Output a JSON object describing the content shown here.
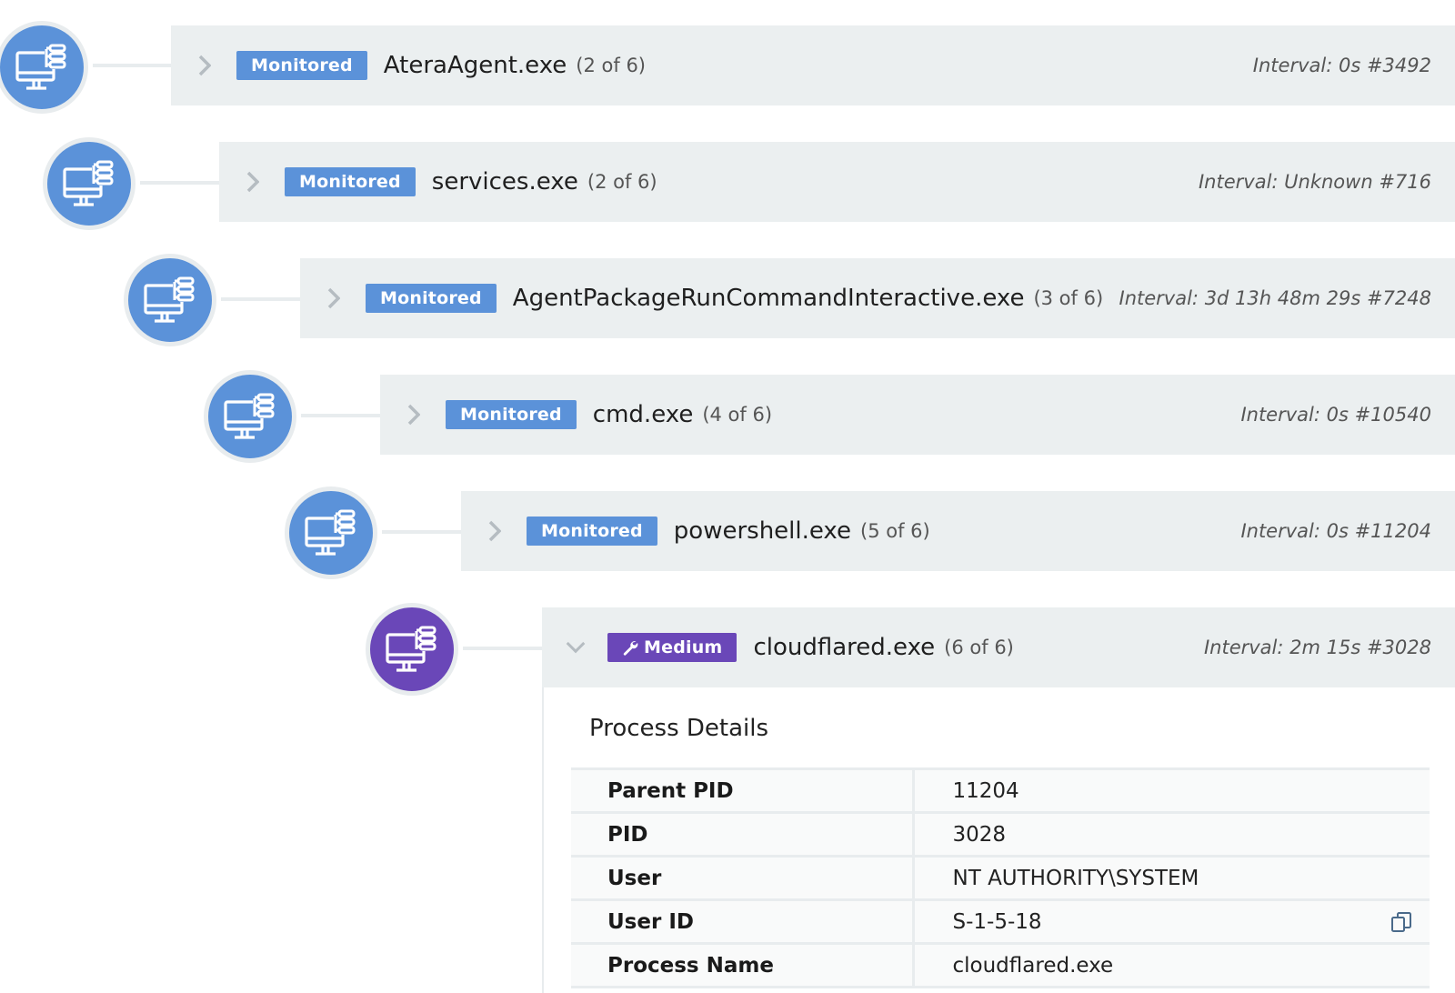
{
  "tree": [
    {
      "badge": "Monitored",
      "name": "AteraAgent.exe",
      "count": "(2 of 6)",
      "interval": "Interval: 0s #3492",
      "color": "#5b92d9"
    },
    {
      "badge": "Monitored",
      "name": "services.exe",
      "count": "(2 of 6)",
      "interval": "Interval: Unknown #716",
      "color": "#5b92d9"
    },
    {
      "badge": "Monitored",
      "name": "AgentPackageRunCommandInteractive.exe",
      "count": "(3 of 6)",
      "interval": "Interval: 3d 13h 48m 29s #7248",
      "color": "#5b92d9"
    },
    {
      "badge": "Monitored",
      "name": "cmd.exe",
      "count": "(4 of 6)",
      "interval": "Interval: 0s #10540",
      "color": "#5b92d9"
    },
    {
      "badge": "Monitored",
      "name": "powershell.exe",
      "count": "(5 of 6)",
      "interval": "Interval: 0s #11204",
      "color": "#5b92d9"
    },
    {
      "badge": "Medium",
      "name": "cloudflared.exe",
      "count": "(6 of 6)",
      "interval": "Interval: 2m 15s #3028",
      "color": "#6a47b8",
      "badge_icon": "wrench-icon"
    }
  ],
  "details": {
    "title": "Process Details",
    "rows": [
      {
        "key": "Parent PID",
        "value": "11204"
      },
      {
        "key": "PID",
        "value": "3028"
      },
      {
        "key": "User",
        "value": "NT AUTHORITY\\SYSTEM"
      },
      {
        "key": "User ID",
        "value": "S-1-5-18",
        "action_icon": "copy-icon"
      },
      {
        "key": "Process Name",
        "value": "cloudflared.exe"
      }
    ]
  },
  "icons": {
    "node": "computer-network-icon",
    "expand": "chevron-right-icon",
    "collapse": "chevron-down-icon"
  }
}
